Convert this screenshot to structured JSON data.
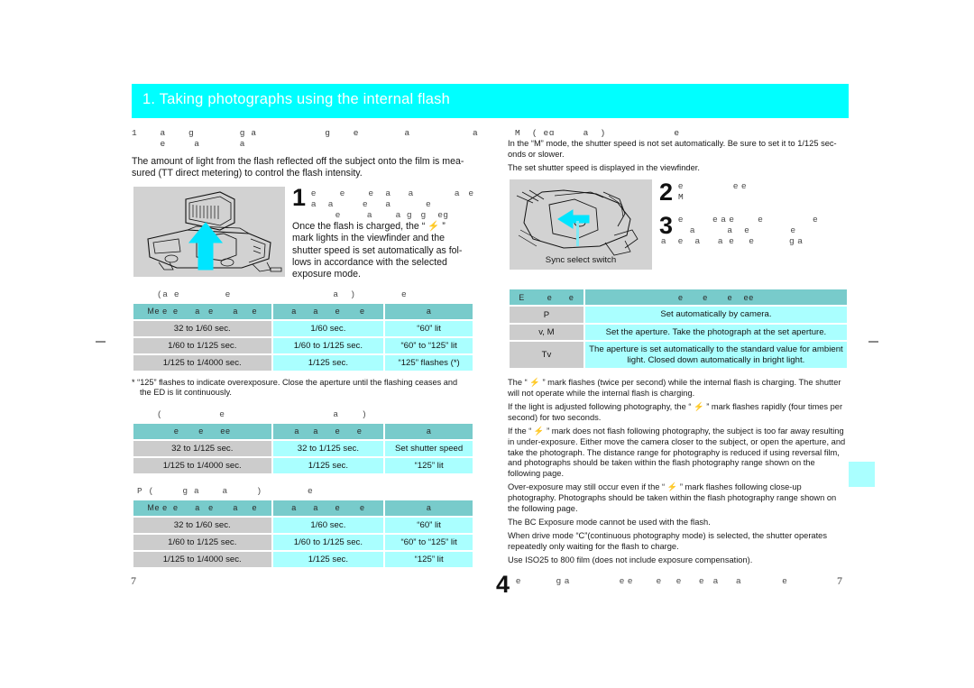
{
  "banner": {
    "title": "1. Taking photographs using the internal flash"
  },
  "left": {
    "heading_ghost_line1": "1    a    g        g a            g    e        a           a",
    "heading_ghost_line2": "     e     a       a",
    "intro": "The amount of light from the flash reflected off the subject onto the film is mea-sured (TT  direct metering) to control the flash intensity.",
    "intro_line1": "The amount of light from the flash reflected off the subject onto the film is mea-",
    "intro_line2": "sured (TT   direct metering) to control the flash intensity.",
    "step1": {
      "numeral": "1",
      "ghost_line1": "e        e        e    a      a              a   e",
      "ghost_line2": "a    a          e      a            e",
      "ghost_line3": "        e         a        a  g   g    eg",
      "text_line1": "Once the flash is charged, the “ ⚡ ”",
      "text_line2": "mark lights in the viewfinder and the",
      "text_line3": "shutter speed is set automatically as fol-",
      "text_line4": "lows in accordance with the selected",
      "text_line5": "exposure mode."
    },
    "table1": {
      "caption": "(a e        e                  a  )        e",
      "headers": [
        "Me e  e      a   e       a     e",
        "a      a      e       e",
        "a"
      ],
      "rows": [
        [
          "32 to 1/60 sec.",
          "1/60 sec.",
          "“60” lit"
        ],
        [
          "1/60 to 1/125 sec.",
          "1/60 to 1/125 sec.",
          "“60” to “125” lit"
        ],
        [
          "1/125 to 1/4000 sec.",
          "1/125 sec.",
          "“125” flashes (*)"
        ]
      ]
    },
    "footnote_line1": "*  “125” flashes to indicate overexposure. Close the aperture until the flashing ceases and",
    "footnote_line2": "the   ED is lit continuously.",
    "table2": {
      "caption": "(          e                   a    )",
      "headers": [
        "e       e      ee",
        "a     a      e      e",
        "a"
      ],
      "rows": [
        [
          "32 to 1/125 sec.",
          "32 to 1/125 sec.",
          "Set shutter speed"
        ],
        [
          "1/125 to 1/4000 sec.",
          "1/125 sec.",
          "“125” lit"
        ]
      ]
    },
    "table3": {
      "caption": "P (     g a    a     )        e",
      "headers": [
        "Me e  e      a   e       a     e",
        "a      a      e       e",
        "a"
      ],
      "rows": [
        [
          "32 to 1/60 sec.",
          "1/60 sec.",
          "“60” lit"
        ],
        [
          "1/60 to 1/125 sec.",
          "1/60 to 1/125 sec.",
          "“60” to “125” lit"
        ],
        [
          "1/125 to 1/4000 sec.",
          "1/125 sec.",
          "“125” lit"
        ]
      ]
    },
    "page_number": "7"
  },
  "right": {
    "heading_ghost": "M  ( eɑ     a  )            e",
    "note_line1": "In the “M” mode, the shutter speed is not set automatically. Be sure to set it to 1/125 sec-",
    "note_line2": " onds or slower.",
    "note_line3": "The set shutter speed is displayed in the viewfinder.",
    "figure_label": "Sync select switch",
    "step2": {
      "numeral": "2",
      "ghost_line1": "e                 e e",
      "ghost_line2": "M"
    },
    "step3": {
      "numeral": "3",
      "ghost_line1": "e          e a e        e                 e",
      "ghost_line2": "    a           a    e              e",
      "ghost_line3": "a    e    a      a  e     e            g a"
    },
    "table4": {
      "headers": [
        "E        e      e",
        "e       e       e    ee"
      ],
      "rows": [
        [
          "P",
          "Set automatically by camera."
        ],
        [
          "v, M",
          "Set the aperture. Take the photograph at the set aperture."
        ],
        [
          "Tv",
          "The aperture is set automatically to the standard value for ambient light. Closed down automatically in bright light."
        ]
      ]
    },
    "bullets": [
      "The “ ⚡ ” mark flashes (twice per second) while the internal flash is charging. The shutter will not operate while the internal flash is charging.",
      "If the light is adjusted following photography, the “ ⚡ ” mark flashes rapidly (four times per second) for two seconds.",
      "If the “ ⚡ ” mark does not flash following photography, the subject is too far away resulting in under-exposure. Either move the camera closer to the subject, or open the aperture, and take the photograph. The distance range for photography is reduced if using reversal film, and photographs should be taken within the flash photography range shown on the following page.",
      "Over-exposure may still occur even if the “ ⚡ ” mark flashes following close-up photography. Photographs should be taken within the flash photography range shown on the following page.",
      "The   BC Exposure mode cannot be used with the flash.",
      "When drive mode “C”(continuous photography mode) is selected, the shutter operates repeatedly only waiting for the flash to charge.",
      "Use ISO25 to 800 film (does not include exposure compensation)."
    ],
    "step4": {
      "numeral": "4",
      "ghost": "e            g a                 e e        e     e      e   a      a              e"
    },
    "page_number": "7"
  }
}
